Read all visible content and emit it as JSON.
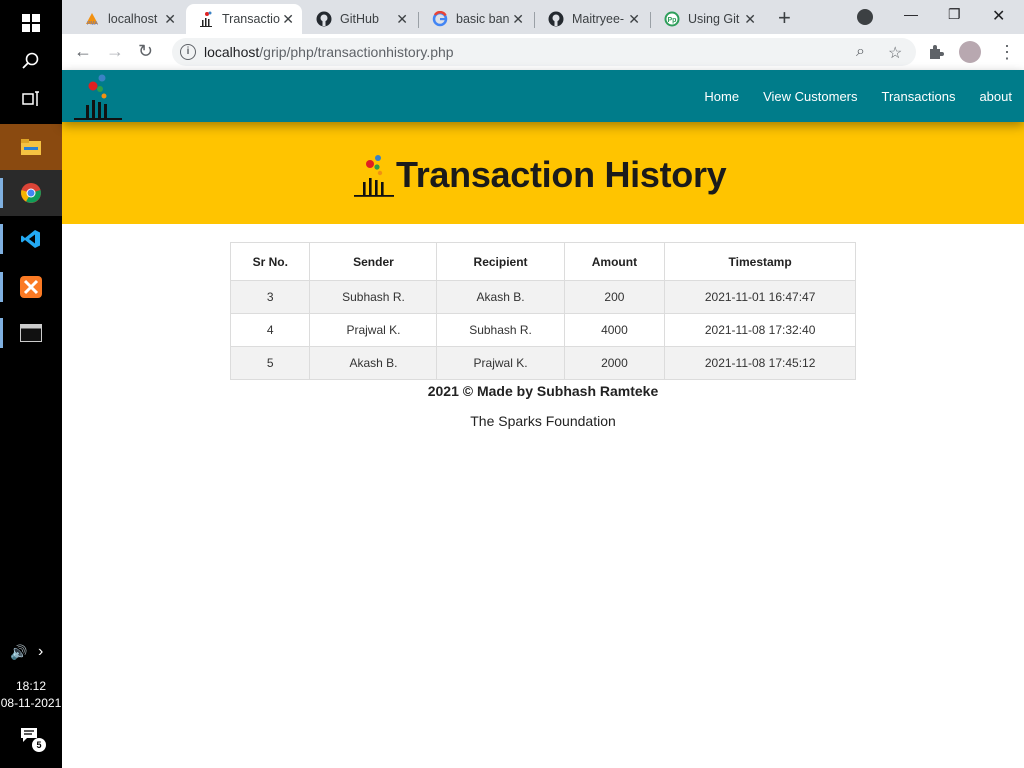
{
  "taskbar": {
    "time": "18:12",
    "date": "08-11-2021",
    "notification_count": "5"
  },
  "browser": {
    "tabs": [
      {
        "title": "localhost",
        "icon": "phpmyadmin-icon"
      },
      {
        "title": "Transactio",
        "icon": "site-logo-icon"
      },
      {
        "title": "GitHub",
        "icon": "github-icon"
      },
      {
        "title": "basic ban",
        "icon": "google-icon"
      },
      {
        "title": "Maitryee-",
        "icon": "github-icon"
      },
      {
        "title": "Using Git",
        "icon": "pp-icon"
      }
    ],
    "url_host": "localhost",
    "url_path": "/grip/php/transactionhistory.php"
  },
  "navbar": {
    "links": [
      "Home",
      "View Customers",
      "Transactions",
      "about"
    ]
  },
  "page": {
    "title": "Transaction History"
  },
  "table": {
    "headers": [
      "Sr No.",
      "Sender",
      "Recipient",
      "Amount",
      "Timestamp"
    ],
    "rows": [
      [
        "3",
        "Subhash R.",
        "Akash B.",
        "200",
        "2021-11-01 16:47:47"
      ],
      [
        "4",
        "Prajwal K.",
        "Subhash R.",
        "4000",
        "2021-11-08 17:32:40"
      ],
      [
        "5",
        "Akash B.",
        "Prajwal K.",
        "2000",
        "2021-11-08 17:45:12"
      ]
    ]
  },
  "footer": {
    "credit": "2021 © Made by Subhash Ramteke",
    "org": "The Sparks Foundation"
  },
  "colors": {
    "navbar": "#007c8a",
    "hero": "#ffc400"
  }
}
